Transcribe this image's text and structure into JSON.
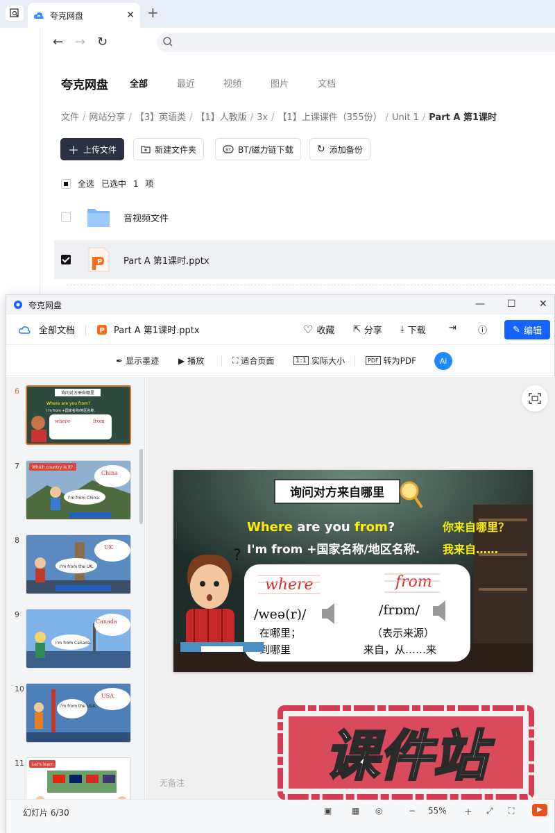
{
  "browser": {
    "tab_title": "夸克网盘",
    "tab_close": "✕",
    "new_tab": "+"
  },
  "drive": {
    "brand": "夸克网盘",
    "categories": [
      "全部",
      "最近",
      "视频",
      "图片",
      "文档"
    ],
    "breadcrumb": [
      "文件",
      "网站分享",
      "【3】英语类",
      "【1】人教版",
      "3x",
      "【1】上课课件（355份）",
      "Unit 1",
      "Part A 第1课时"
    ],
    "breadcrumb_sep": "/",
    "actions": {
      "upload": "上传文件",
      "new_folder": "新建文件夹",
      "bt": "BT/磁力链下载",
      "backup": "添加备份"
    },
    "select_all": "全选",
    "selected_label": "已选中",
    "selected_count": "1",
    "selected_unit": "项",
    "files": [
      {
        "name": "音视频文件",
        "type": "folder",
        "checked": false
      },
      {
        "name": "Part  A 第1课时.pptx",
        "type": "pptx",
        "checked": true
      }
    ]
  },
  "viewer": {
    "window_title": "夸克网盘",
    "back_label": "全部文档",
    "file_name": "Part A 第1课时.pptx",
    "toolbar": {
      "favorite": "收藏",
      "share": "分享",
      "download": "下载",
      "edit": "编辑"
    },
    "toolbar2": {
      "ink": "显示墨迹",
      "play": "播放",
      "fit": "适合页面",
      "actual": "实际大小",
      "to_pdf": "转为PDF"
    },
    "thumbnails": [
      {
        "num": "6",
        "active": true,
        "banner": "询问对方来自哪里"
      },
      {
        "num": "7",
        "active": false,
        "banner": "Which country is it?",
        "word": "China",
        "line": "I'm from China."
      },
      {
        "num": "8",
        "active": false,
        "word": "UK",
        "line": "I'm from the UK."
      },
      {
        "num": "9",
        "active": false,
        "word": "Canada",
        "line": "I'm from Canada."
      },
      {
        "num": "10",
        "active": false,
        "word": "USA",
        "line": "I'm from the USA."
      },
      {
        "num": "11",
        "active": false,
        "banner": "Let's learn"
      }
    ],
    "slide": {
      "title": "询问对方来自哪里",
      "q_en_1": "Where",
      "q_en_2": " are you ",
      "q_en_3": "from",
      "q_en_4": "?",
      "q_cn": "你来自哪里？",
      "a_en": "I'm from +国家名称/地区名称.",
      "a_cn": "我来自……",
      "word1": "where",
      "word2": "from",
      "ipa1": "/weə(r)/",
      "ipa2": "/frɒm/",
      "mean1a": "在哪里；",
      "mean1b": "到哪里",
      "mean2a": "（表示来源）",
      "mean2b": "来自，从……来"
    },
    "notes": "无备注",
    "slide_counter": "幻灯片 6/30",
    "zoom": "55%"
  },
  "watermark": "课件站"
}
